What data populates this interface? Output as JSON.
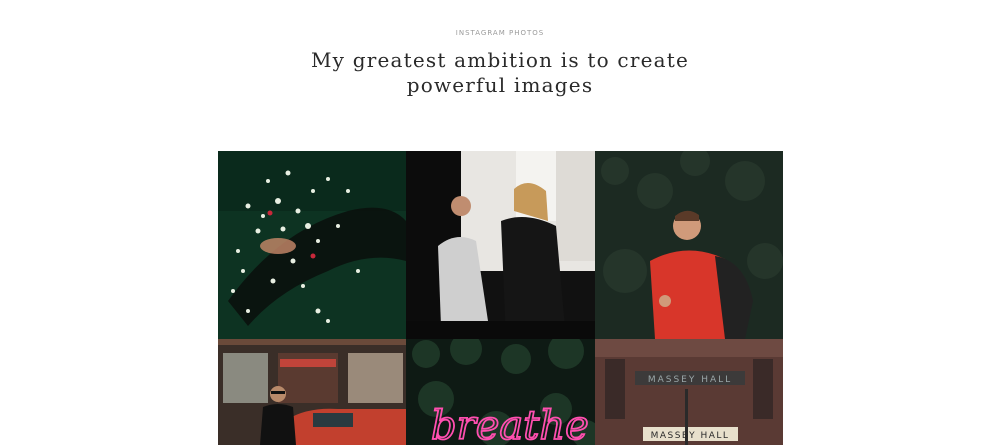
{
  "header": {
    "eyebrow": "INSTAGRAM PHOTOS",
    "title_line1": "My greatest ambition is to create",
    "title_line2": "powerful images"
  },
  "gallery": {
    "photos": [
      {
        "subject": "woman lying among white flowers on dark green",
        "accent": "#0f3a26"
      },
      {
        "subject": "couple laughing in a kitchen",
        "accent": "#1a1a1a"
      },
      {
        "subject": "man in red jacket with backpack looking up",
        "accent": "#d83a2a"
      },
      {
        "subject": "man in sunglasses beside red vintage car",
        "accent": "#b8442e"
      },
      {
        "subject": "pink neon sign on green foliage",
        "accent": "#ff3fa0"
      },
      {
        "subject": "brick building with Massey Hall sign",
        "accent": "#6b4a40"
      }
    ],
    "neon_text": "breathe",
    "building_sign": "MASSEY HALL",
    "building_sign_upper": "MASSEY HALL"
  }
}
